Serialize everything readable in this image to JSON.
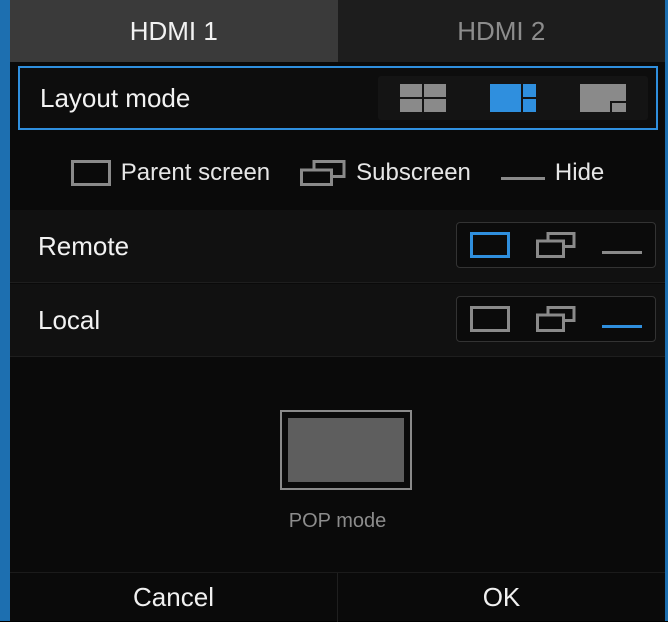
{
  "tabs": [
    {
      "label": "HDMI 1",
      "active": true
    },
    {
      "label": "HDMI 2",
      "active": false
    }
  ],
  "layout_mode": {
    "label": "Layout mode",
    "options": [
      "split-four-icon",
      "split-main-side-icon",
      "pip-icon"
    ],
    "selected": "split-main-side-icon"
  },
  "legend": {
    "parent": "Parent screen",
    "subscreen": "Subscreen",
    "hide": "Hide"
  },
  "rows": {
    "remote": {
      "label": "Remote",
      "selected": "parent"
    },
    "local": {
      "label": "Local",
      "selected": "hide"
    }
  },
  "preview": {
    "caption": "POP mode"
  },
  "footer": {
    "cancel": "Cancel",
    "ok": "OK"
  },
  "colors": {
    "accent": "#2f8fde",
    "inactive_icon": "#8a8a8a",
    "tab_active_bg": "#3a3a3a",
    "tab_inactive_bg": "#1d1d1d"
  }
}
